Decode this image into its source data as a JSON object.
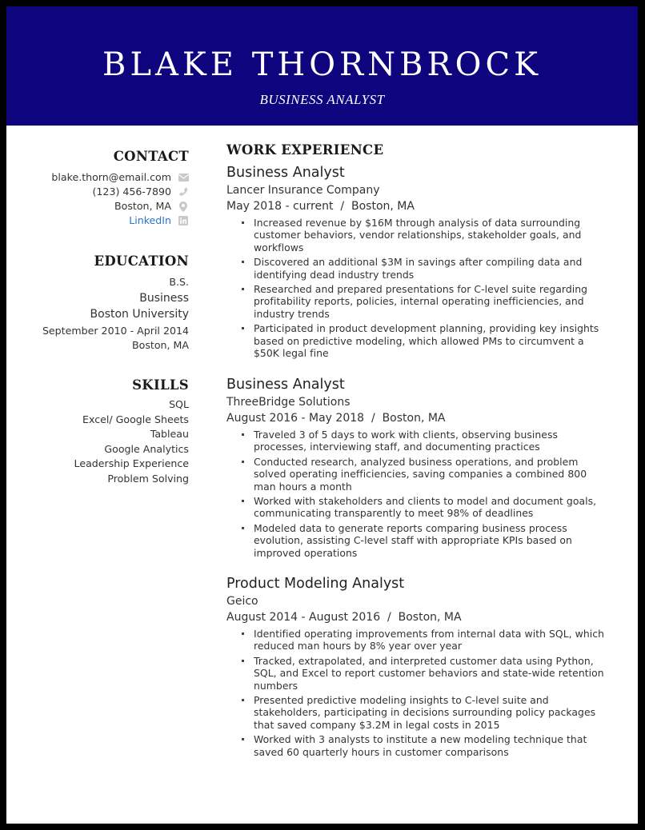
{
  "header": {
    "name": "BLAKE THORNBROCK",
    "title": "BUSINESS ANALYST",
    "background_color": "#0d047e"
  },
  "contact": {
    "heading": "CONTACT",
    "items": [
      {
        "text": "blake.thorn@email.com",
        "icon": "envelope-icon"
      },
      {
        "text": "(123) 456-7890",
        "icon": "phone-icon"
      },
      {
        "text": "Boston, MA",
        "icon": "map-pin-icon"
      },
      {
        "text": "LinkedIn",
        "icon": "linkedin-icon",
        "link_color": "#2a73d0"
      }
    ]
  },
  "education": {
    "heading": "EDUCATION",
    "degree": "B.S.",
    "field": "Business",
    "school": "Boston University",
    "dates": "September 2010 - April 2014",
    "location": "Boston, MA"
  },
  "skills": {
    "heading": "SKILLS",
    "items": [
      "SQL",
      "Excel/ Google Sheets",
      "Tableau",
      "Google Analytics",
      "Leadership Experience",
      "Problem Solving"
    ]
  },
  "experience": {
    "heading": "WORK EXPERIENCE",
    "jobs": [
      {
        "title": "Business Analyst",
        "company": "Lancer Insurance Company",
        "dates": "May 2018 - current  /  Boston, MA",
        "bullets": [
          "Increased revenue by $16M through analysis of data surrounding customer behaviors, vendor relationships, stakeholder goals, and workflows",
          "Discovered an additional $3M in savings after compiling data and identifying dead industry trends",
          "Researched and prepared presentations for C-level suite regarding profitability reports, policies, internal operating inefficiencies, and industry trends",
          "Participated in product development planning, providing key insights based on predictive modeling, which allowed PMs to circumvent a $50K legal fine"
        ]
      },
      {
        "title": "Business Analyst",
        "company": "ThreeBridge Solutions",
        "dates": "August 2016 - May 2018  /  Boston, MA",
        "bullets": [
          "Traveled 3 of 5 days to work with clients, observing business processes, interviewing staff, and documenting practices",
          "Conducted research, analyzed business operations, and problem solved operating inefficiencies, saving companies a combined 800 man hours a month",
          "Worked with stakeholders and clients to model and document goals, communicating transparently to meet 98% of deadlines",
          "Modeled data to generate reports comparing business process evolution, assisting C-level staff with appropriate KPIs based on improved operations"
        ]
      },
      {
        "title": "Product Modeling Analyst",
        "company": "Geico",
        "dates": "August 2014 - August 2016  /  Boston, MA",
        "bullets": [
          "Identified operating improvements from internal data with SQL, which reduced man hours by 8% year over year",
          "Tracked, extrapolated, and interpreted customer data using Python, SQL, and Excel to report customer behaviors and state-wide retention numbers",
          "Presented predictive modeling insights to C-level suite and stakeholders, participating in decisions surrounding policy packages that saved company $3.2M in legal costs in 2015",
          "Worked with 3 analysts to institute a new modeling technique that saved 60 quarterly hours in customer comparisons"
        ]
      }
    ]
  }
}
